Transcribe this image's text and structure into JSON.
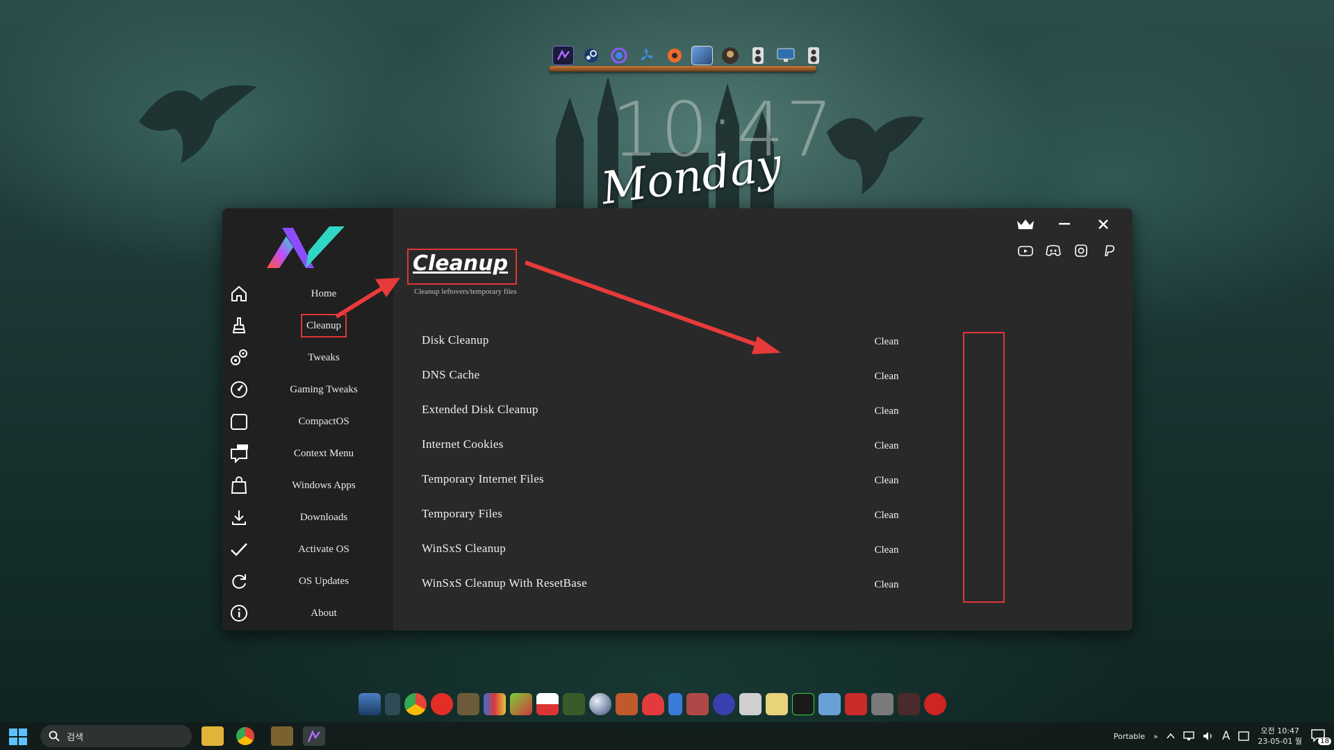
{
  "wallpaper": {
    "clock_time": "10:47",
    "day": "Monday"
  },
  "top_dock": {
    "icons": [
      "atlas-icon",
      "steam-icon",
      "orb-icon",
      "fan-icon",
      "orange-circle-icon",
      "game-tile-icon",
      "avatar-icon",
      "speaker-icon",
      "monitor-icon",
      "speaker-icon"
    ]
  },
  "app": {
    "sidebar": {
      "items": [
        {
          "label": "Home",
          "icon": "home-icon"
        },
        {
          "label": "Cleanup",
          "icon": "broom-icon"
        },
        {
          "label": "Tweaks",
          "icon": "gears-icon"
        },
        {
          "label": "Gaming Tweaks",
          "icon": "speedometer-icon"
        },
        {
          "label": "CompactOS",
          "icon": "drive-icon"
        },
        {
          "label": "Context Menu",
          "icon": "new-comment-icon"
        },
        {
          "label": "Windows Apps",
          "icon": "bag-icon"
        },
        {
          "label": "Downloads",
          "icon": "download-icon"
        },
        {
          "label": "Activate OS",
          "icon": "check-icon"
        },
        {
          "label": "OS Updates",
          "icon": "refresh-icon"
        },
        {
          "label": "About",
          "icon": "info-icon"
        }
      ],
      "active": "Cleanup"
    },
    "header": {
      "title": "Cleanup",
      "subtitle": "Cleanup leftovers/temporary files"
    },
    "rows": [
      {
        "label": "Disk Cleanup",
        "action": "Clean"
      },
      {
        "label": "DNS Cache",
        "action": "Clean"
      },
      {
        "label": "Extended Disk Cleanup",
        "action": "Clean"
      },
      {
        "label": "Internet Cookies",
        "action": "Clean"
      },
      {
        "label": "Temporary Internet Files",
        "action": "Clean"
      },
      {
        "label": "Temporary Files",
        "action": "Clean"
      },
      {
        "label": "WinSxS Cleanup",
        "action": "Clean"
      },
      {
        "label": "WinSxS Cleanup With ResetBase",
        "action": "Clean"
      }
    ],
    "window_controls": [
      "crown-icon",
      "minimize-icon",
      "close-icon"
    ],
    "social_links": [
      "youtube-icon",
      "discord-icon",
      "instagram-icon",
      "paypal-icon"
    ],
    "highlight_color": "#e03636"
  },
  "taskbar": {
    "search_placeholder": "검색",
    "tray": {
      "portable": "Portable",
      "chevron": "»",
      "ime": "A",
      "time": "오전 10:47",
      "date": "23-05-01 월",
      "notification_count": "18"
    }
  }
}
